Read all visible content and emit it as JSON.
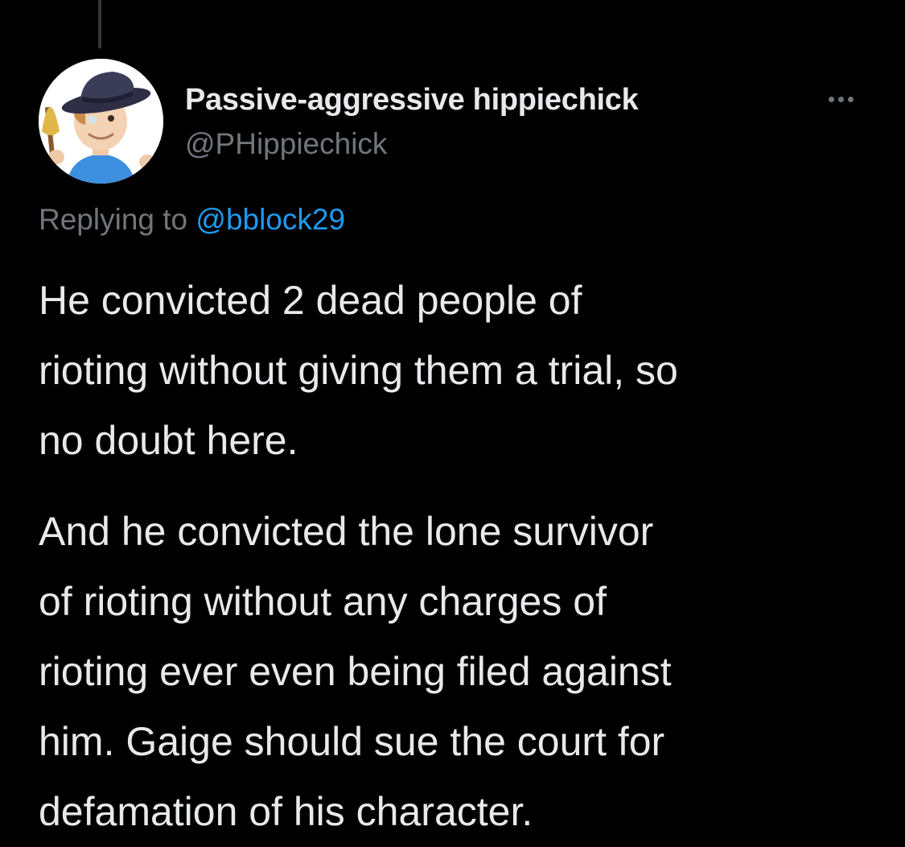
{
  "tweet": {
    "author": {
      "display_name": "Passive-aggressive hippiechick",
      "handle": "@PHippiechick",
      "avatar_icon": "memoji-avatar-icon"
    },
    "more_icon": "more-options-icon",
    "reply_context": {
      "prefix": "Replying to ",
      "mention": "@bblock29"
    },
    "paragraphs": [
      "He convicted 2 dead people of\nrioting without giving them a trial, so\nno doubt here.",
      "And he convicted the lone survivor\nof rioting without any charges of\nrioting ever even being filed against\nhim. Gaige should sue the court for\ndefamation of his character."
    ]
  },
  "colors": {
    "background": "#000000",
    "primary_text": "#e7e9ea",
    "secondary_text": "#71767b",
    "link": "#1d9bf0",
    "thread_line": "#333639"
  }
}
